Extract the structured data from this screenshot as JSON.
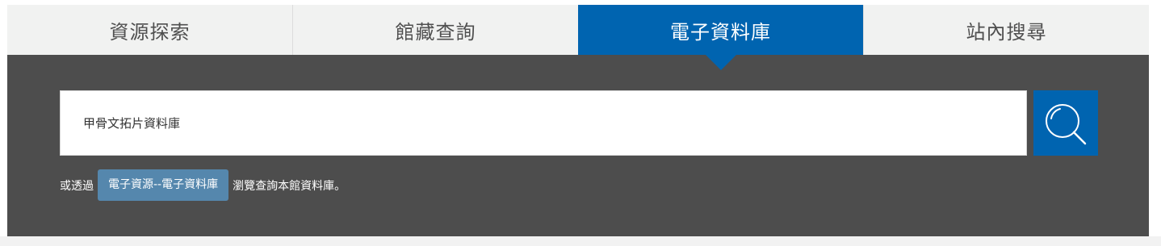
{
  "tabs": [
    {
      "label": "資源探索",
      "active": false
    },
    {
      "label": "館藏查詢",
      "active": false
    },
    {
      "label": "電子資料庫",
      "active": true
    },
    {
      "label": "站內搜尋",
      "active": false
    }
  ],
  "search": {
    "value": "甲骨文拓片資料庫",
    "button_icon": "search-icon"
  },
  "hint": {
    "prefix": "或透過",
    "link_label": "電子資源--電子資料庫",
    "suffix": "瀏覽查詢本館資料庫。"
  },
  "colors": {
    "accent": "#0064b0",
    "panel": "#4d4d4d",
    "tab_bg": "#f1f2f1",
    "link_bg": "#5587ad"
  }
}
